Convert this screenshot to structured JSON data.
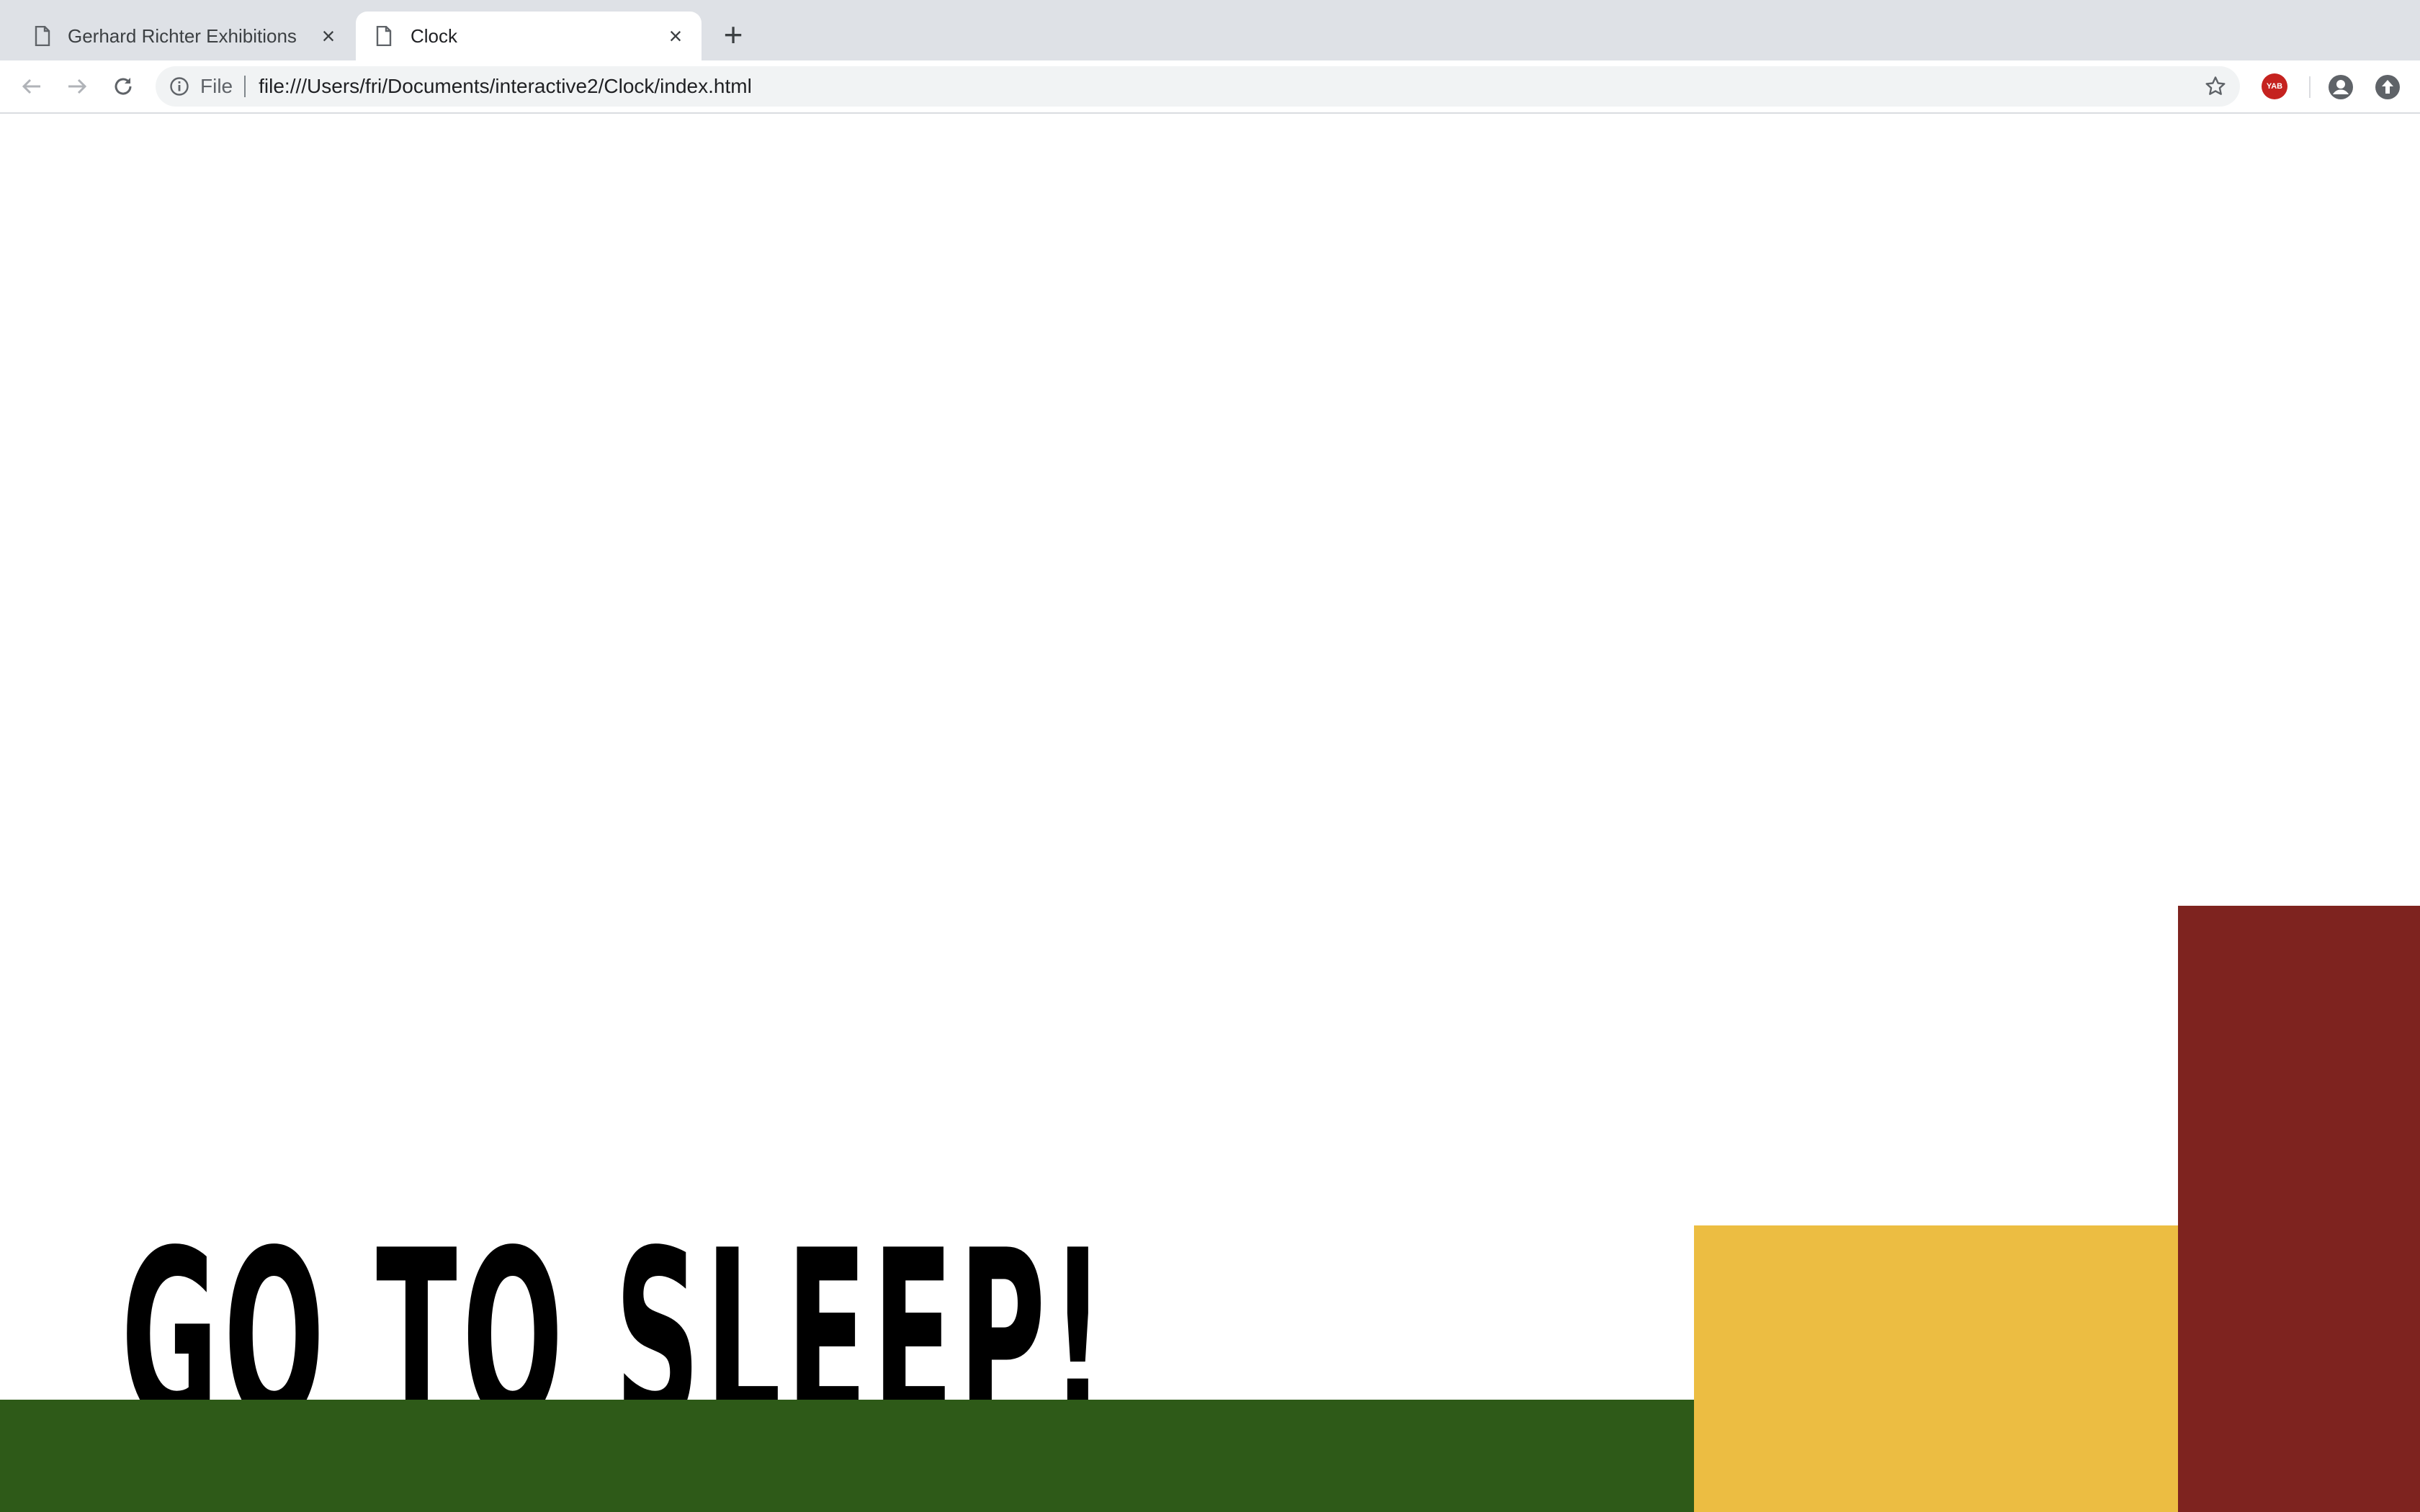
{
  "browser": {
    "tabs": [
      {
        "title": "Gerhard Richter Exhibitions",
        "icon": "page-icon",
        "active": false
      },
      {
        "title": "Clock",
        "icon": "page-icon",
        "active": true
      }
    ],
    "new_tab_label": "+",
    "close_label": "×",
    "address": {
      "scheme_label": "File",
      "url": "file:///Users/fri/Documents/interactive2/Clock/index.html"
    },
    "extension_badge": "YAB"
  },
  "page": {
    "message": "GO TO SLEEP!",
    "colors": {
      "green": "#2e5a18",
      "yellow": "#ecbd42",
      "red": "#7e231f",
      "text": "#000000"
    }
  }
}
